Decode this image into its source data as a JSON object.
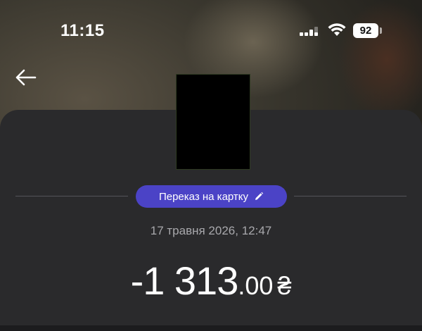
{
  "status_bar": {
    "time": "11:15",
    "battery": "92",
    "icons": [
      "signal-icon",
      "wifi-icon",
      "battery-icon"
    ]
  },
  "header": {
    "back_icon": "arrow-left-icon"
  },
  "transaction": {
    "category": "Переказ на картку",
    "category_icon": "pencil-icon",
    "datetime": "17 травня 2026, 12:47",
    "amount_integer": "-1 313",
    "amount_decimal": ".00",
    "currency": "₴"
  },
  "colors": {
    "chip": "#4b43c6",
    "sheet": "#2a2a2c",
    "secondary_text": "#a8a8ac"
  }
}
